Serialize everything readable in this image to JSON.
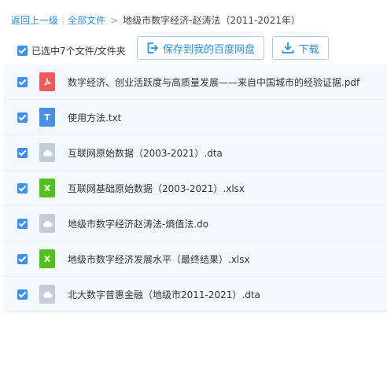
{
  "breadcrumb": {
    "back": "返回上一级",
    "separator": "|",
    "all_files": "全部文件",
    "arrow": ">",
    "current": "地级市数字经济-赵涛法（2011-2021年）"
  },
  "toolbar": {
    "selection_text": "已选中7个文件/文件夹",
    "save_label": "保存到我的百度网盘",
    "download_label": "下载"
  },
  "colors": {
    "accent": "#2b8fe6",
    "checkbox": "#3d8ff0",
    "row_bg": "#f3f9ff",
    "pdf": "#f05a5a",
    "txt": "#4a90e2",
    "xlsx": "#52c11e",
    "generic": "#c4cdd7"
  },
  "files": [
    {
      "name": "数字经济、创业活跃度与高质量发展——来自中国城市的经验证据.pdf",
      "icon": "pdf-file-icon",
      "checked": true
    },
    {
      "name": "使用方法.txt",
      "icon": "text-file-icon",
      "checked": true
    },
    {
      "name": "互联网原始数据（2003-2021）.dta",
      "icon": "cloud-file-icon",
      "checked": true
    },
    {
      "name": "互联网基础原始数据（2003-2021）.xlsx",
      "icon": "excel-file-icon",
      "checked": true
    },
    {
      "name": "地级市数字经济赵涛法-熵值法.do",
      "icon": "cloud-file-icon",
      "checked": true
    },
    {
      "name": "地级市数字经济发展水平（最终结果）.xlsx",
      "icon": "excel-file-icon",
      "checked": true
    },
    {
      "name": "北大数字普惠金融（地级市2011-2021）.dta",
      "icon": "cloud-file-icon",
      "checked": true
    }
  ]
}
